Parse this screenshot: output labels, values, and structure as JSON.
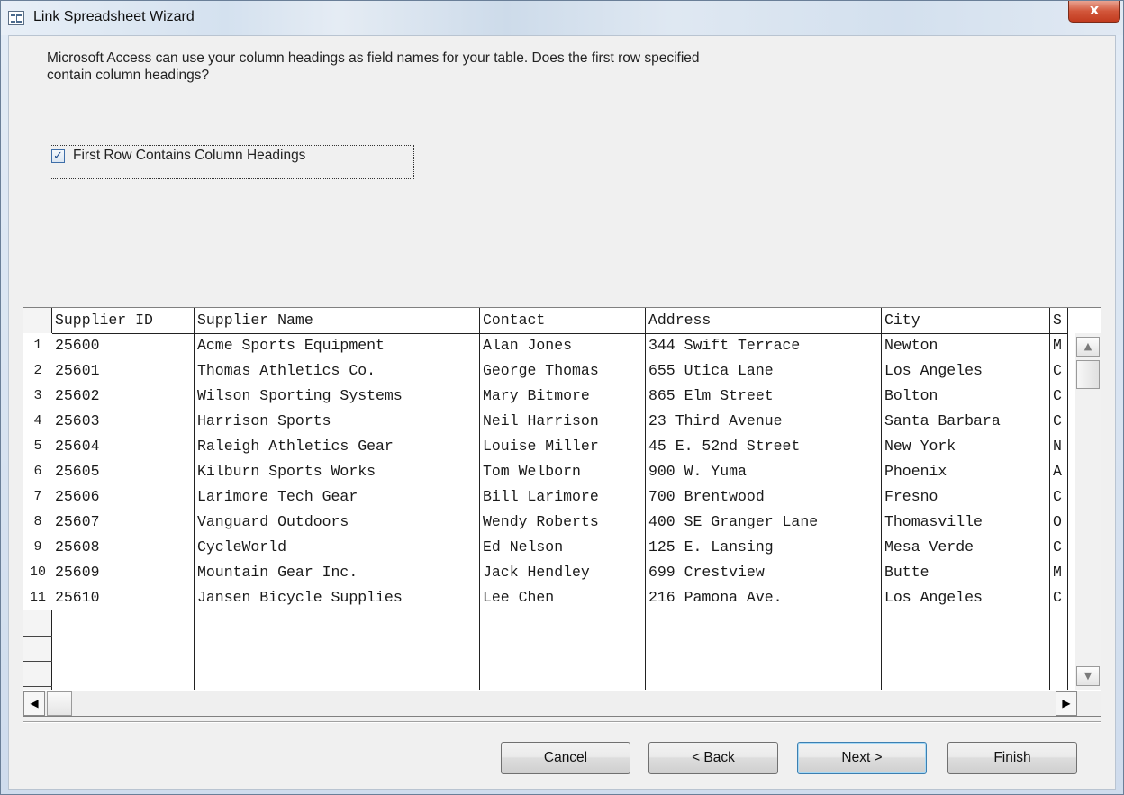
{
  "window": {
    "title": "Link Spreadsheet Wizard",
    "close_label": "x"
  },
  "instructions": "Microsoft Access can use your column headings as field names for your table. Does the first row specified contain column headings?",
  "checkbox": {
    "label": "First Row Contains Column Headings",
    "checked": true,
    "mark": "✓"
  },
  "table": {
    "columns": [
      "Supplier ID",
      "Supplier Name",
      "Contact",
      "Address",
      "City",
      "S"
    ],
    "rows": [
      [
        "25600",
        "Acme Sports Equipment",
        "Alan Jones",
        "344 Swift Terrace",
        "Newton",
        "M"
      ],
      [
        "25601",
        "Thomas Athletics Co.",
        "George Thomas",
        "655 Utica Lane",
        "Los Angeles",
        "C"
      ],
      [
        "25602",
        "Wilson Sporting Systems",
        "Mary Bitmore",
        "865 Elm Street",
        "Bolton",
        "C"
      ],
      [
        "25603",
        "Harrison Sports",
        "Neil Harrison",
        "23 Third Avenue",
        "Santa Barbara",
        "C"
      ],
      [
        "25604",
        "Raleigh Athletics Gear",
        "Louise Miller",
        "45 E. 52nd Street",
        "New York",
        "N"
      ],
      [
        "25605",
        "Kilburn Sports Works",
        "Tom Welborn",
        "900 W. Yuma",
        "Phoenix",
        "A"
      ],
      [
        "25606",
        "Larimore Tech Gear",
        "Bill Larimore",
        "700 Brentwood",
        "Fresno",
        "C"
      ],
      [
        "25607",
        "Vanguard Outdoors",
        "Wendy Roberts",
        "400 SE Granger Lane",
        "Thomasville",
        "O"
      ],
      [
        "25608",
        "CycleWorld",
        "Ed Nelson",
        "125 E. Lansing",
        "Mesa Verde",
        "C"
      ],
      [
        "25609",
        "Mountain Gear Inc.",
        "Jack Hendley",
        "699 Crestview",
        "Butte",
        "M"
      ],
      [
        "25610",
        "Jansen Bicycle Supplies",
        "Lee Chen",
        "216 Pamona Ave.",
        "Los Angeles",
        "C"
      ]
    ],
    "row_numbers": [
      "1",
      "2",
      "3",
      "4",
      "5",
      "6",
      "7",
      "8",
      "9",
      "10",
      "11"
    ]
  },
  "scrollbar": {
    "up": "▲",
    "down": "▼",
    "left": "◀",
    "right": "▶"
  },
  "buttons": {
    "cancel": "Cancel",
    "back": "< Back",
    "next": "Next >",
    "finish": "Finish"
  }
}
